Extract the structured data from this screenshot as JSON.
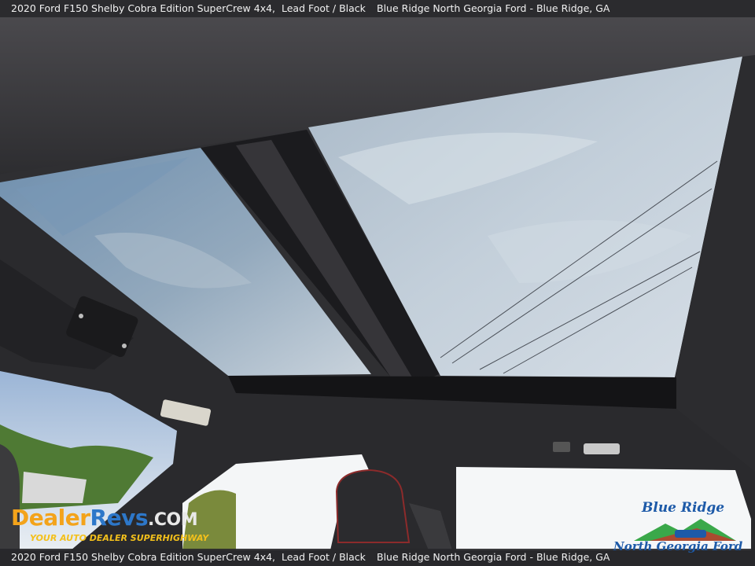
{
  "header": {
    "vehicle": "2020 Ford F150 Shelby Cobra Edition SuperCrew 4x4,",
    "colors": "Lead Foot / Black",
    "dealer": "Blue Ridge North Georgia Ford - Blue Ridge, GA"
  },
  "footer": {
    "vehicle": "2020 Ford F150 Shelby Cobra Edition SuperCrew 4x4,",
    "colors": "Lead Foot / Black",
    "dealer": "Blue Ridge North Georgia Ford - Blue Ridge, GA"
  },
  "watermarks": {
    "dealerrevs": {
      "name_part1": "Dealer",
      "name_part2": "Revs",
      "suffix": ".COM",
      "tagline": "YOUR AUTO DEALER SUPERHIGHWAY"
    },
    "blue_ridge": {
      "line1": "Blue Ridge",
      "line2": "North Georgia Ford"
    }
  },
  "photo": {
    "subject": "panoramic-sunroof-interior",
    "colors": {
      "headliner": "#3a393c",
      "sky": "#8fa6bb",
      "trees": "#4f7a34"
    }
  }
}
